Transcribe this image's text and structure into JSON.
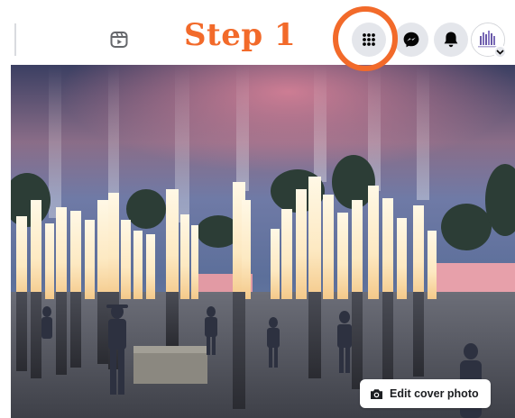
{
  "annotation": {
    "step_label": "Step 1",
    "color": "#f26a2a"
  },
  "topbar": {
    "reels_icon": "reels-icon",
    "menu_icon": "grid-menu-icon",
    "messenger_icon": "messenger-icon",
    "notifications_icon": "bell-icon",
    "profile_icon": "profile-avatar",
    "button_bg": "#e4e6eb"
  },
  "cover": {
    "image": "memorial-light-pillars-night-rendering",
    "edit_button_label": "Edit cover photo",
    "edit_button_icon": "camera-icon"
  }
}
